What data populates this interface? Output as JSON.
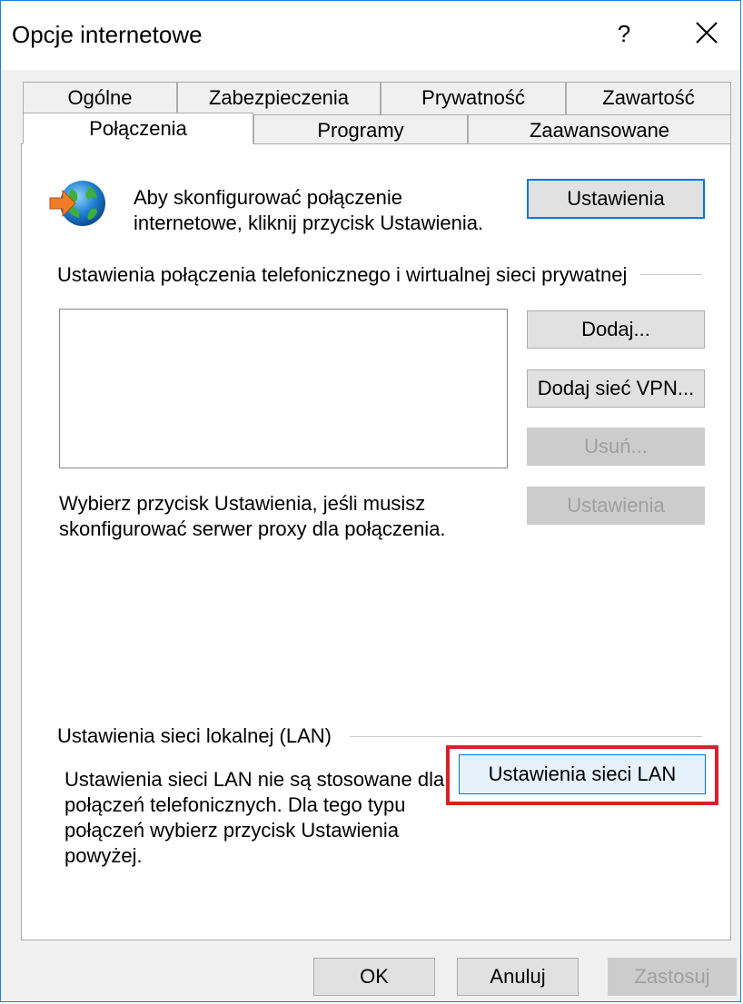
{
  "window": {
    "title": "Opcje internetowe",
    "help_glyph": "?",
    "close_icon": "close-icon"
  },
  "tabs": {
    "row1": [
      "Ogólne",
      "Zabezpieczenia",
      "Prywatność",
      "Zawartość"
    ],
    "row2": [
      "Połączenia",
      "Programy",
      "Zaawansowane"
    ],
    "active": "Połączenia"
  },
  "setup": {
    "icon": "globe-arrow-icon",
    "text_line1": "Aby skonfigurować połączenie",
    "text_line2": "internetowe, kliknij przycisk Ustawienia.",
    "button": "Ustawienia"
  },
  "dialup": {
    "group_label": "Ustawienia połączenia telefonicznego i wirtualnej sieci prywatnej",
    "add_button": "Dodaj...",
    "add_vpn_button": "Dodaj sieć VPN...",
    "remove_button": "Usuń...",
    "settings_button": "Ustawienia",
    "proxy_text_line1": "Wybierz przycisk Ustawienia, jeśli musisz",
    "proxy_text_line2": "skonfigurować serwer proxy dla połączenia."
  },
  "lan": {
    "group_label": "Ustawienia sieci lokalnej (LAN)",
    "text_line1": "Ustawienia sieci LAN nie są stosowane dla",
    "text_line2": "połączeń telefonicznych. Dla tego typu",
    "text_line3": "połączeń wybierz przycisk Ustawienia",
    "text_line4": "powyżej.",
    "button": "Ustawienia sieci LAN",
    "highlight_color": "#d8202a"
  },
  "footer": {
    "ok": "OK",
    "cancel": "Anuluj",
    "apply": "Zastosuj"
  }
}
